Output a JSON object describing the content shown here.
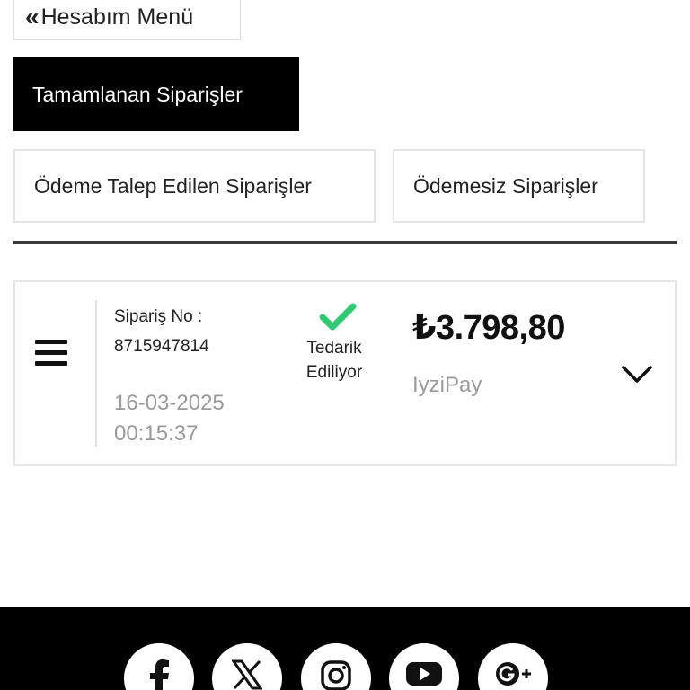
{
  "back": {
    "icon": "double-chevron-left-icon",
    "label": "Hesabım Menü"
  },
  "tabs": {
    "completed": "Tamamlanan Siparişler",
    "payment_requested": "Ödeme Talep Edilen Siparişler",
    "unpaid": "Ödemesiz Siparişler"
  },
  "order": {
    "order_label": "Sipariş No :",
    "order_number": "8715947814",
    "date": "16-03-2025",
    "time": "00:15:37",
    "status_line1": "Tedarik",
    "status_line2": "Ediliyor",
    "price": "₺3.798,80",
    "payment_method": "IyziPay"
  },
  "colors": {
    "accent_green": "#2ecc71",
    "tab_active_bg": "#000000",
    "muted_text": "#9a9a9a"
  },
  "social": [
    "facebook-icon",
    "x-icon",
    "instagram-icon",
    "youtube-icon",
    "google-plus-icon"
  ]
}
